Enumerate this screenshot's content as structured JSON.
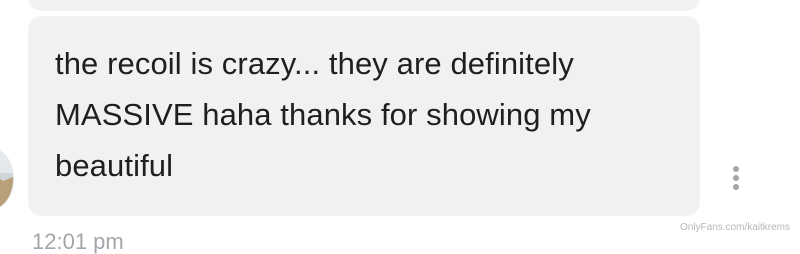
{
  "message": {
    "text": "the recoil is crazy... they are definitely MASSIVE haha thanks for showing my beautiful",
    "timestamp": "12:01 pm"
  },
  "more_options_icon": "vertical-ellipsis",
  "watermark": "OnlyFans.com/kaitkrems",
  "colors": {
    "bubble_background": "#f0f1f3",
    "message_text": "#1f1f1f",
    "timestamp": "#a3a6ab",
    "more_icon": "#a3a6ab"
  }
}
